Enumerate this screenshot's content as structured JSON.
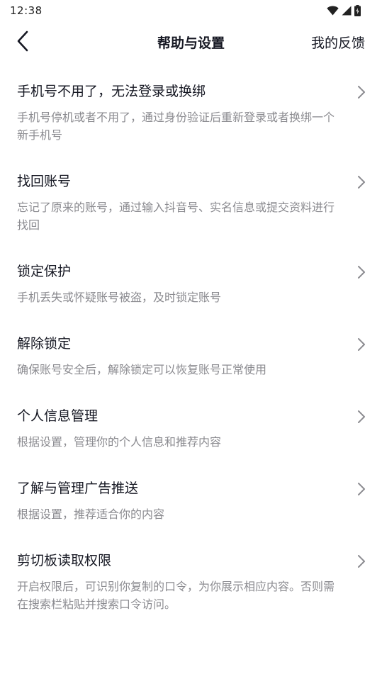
{
  "status_bar": {
    "time": "12:38",
    "icons": [
      "wifi-icon",
      "signal-icon",
      "battery-icon"
    ]
  },
  "nav": {
    "back_icon": "chevron-left-icon",
    "title": "帮助与设置",
    "feedback_label": "我的反馈"
  },
  "items": [
    {
      "title": "手机号不用了，无法登录或换绑",
      "description": "手机号停机或者不用了，通过身份验证后重新登录或者换绑一个新手机号"
    },
    {
      "title": "找回账号",
      "description": "忘记了原来的账号，通过输入抖音号、实名信息或提交资料进行找回"
    },
    {
      "title": "锁定保护",
      "description": "手机丢失或怀疑账号被盗，及时锁定账号"
    },
    {
      "title": "解除锁定",
      "description": "确保账号安全后，解除锁定可以恢复账号正常使用"
    },
    {
      "title": "个人信息管理",
      "description": "根据设置，管理你的个人信息和推荐内容"
    },
    {
      "title": "了解与管理广告推送",
      "description": "根据设置，推荐适合你的内容"
    },
    {
      "title": "剪切板读取权限",
      "description": "开启权限后，可识别你复制的口令，为你展示相应内容。否则需在搜索栏粘贴并搜索口令访问。"
    }
  ],
  "colors": {
    "title_text": "#161823",
    "description_text": "#8b8b90",
    "chevron": "#8b8b90",
    "background": "#ffffff"
  }
}
